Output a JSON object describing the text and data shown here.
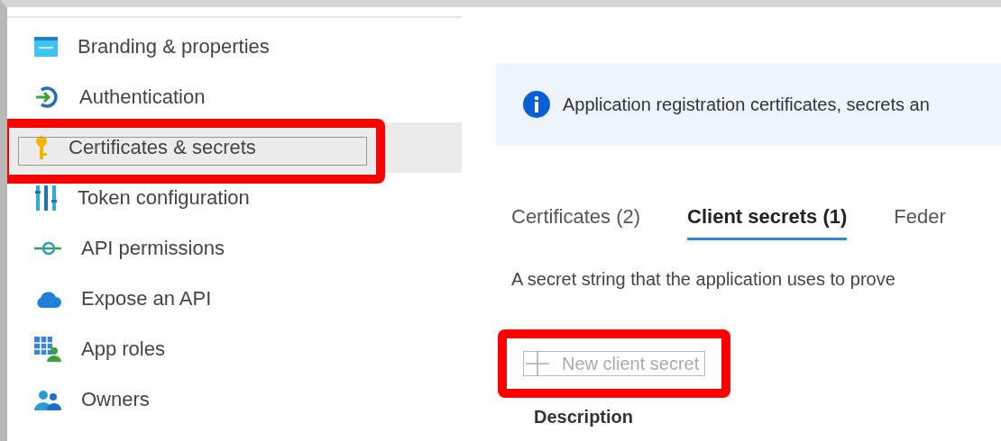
{
  "sidebar": {
    "items": [
      {
        "label": "Branding & properties",
        "selected": false,
        "highlighted": false
      },
      {
        "label": "Authentication",
        "selected": false,
        "highlighted": false
      },
      {
        "label": "Certificates & secrets",
        "selected": true,
        "highlighted": true
      },
      {
        "label": "Token configuration",
        "selected": false,
        "highlighted": false
      },
      {
        "label": "API permissions",
        "selected": false,
        "highlighted": false
      },
      {
        "label": "Expose an API",
        "selected": false,
        "highlighted": false
      },
      {
        "label": "App roles",
        "selected": false,
        "highlighted": false
      },
      {
        "label": "Owners",
        "selected": false,
        "highlighted": false
      }
    ]
  },
  "info_banner": {
    "text": "Application registration certificates, secrets an"
  },
  "tabs": [
    {
      "label": "Certificates (2)",
      "selected": false
    },
    {
      "label": "Client secrets (1)",
      "selected": true
    },
    {
      "label": "Feder",
      "selected": false
    }
  ],
  "description": "A secret string that the application uses to prove",
  "new_button": {
    "label": "New client secret",
    "disabled": true,
    "highlighted": true
  },
  "table": {
    "columns": [
      "Description"
    ]
  }
}
